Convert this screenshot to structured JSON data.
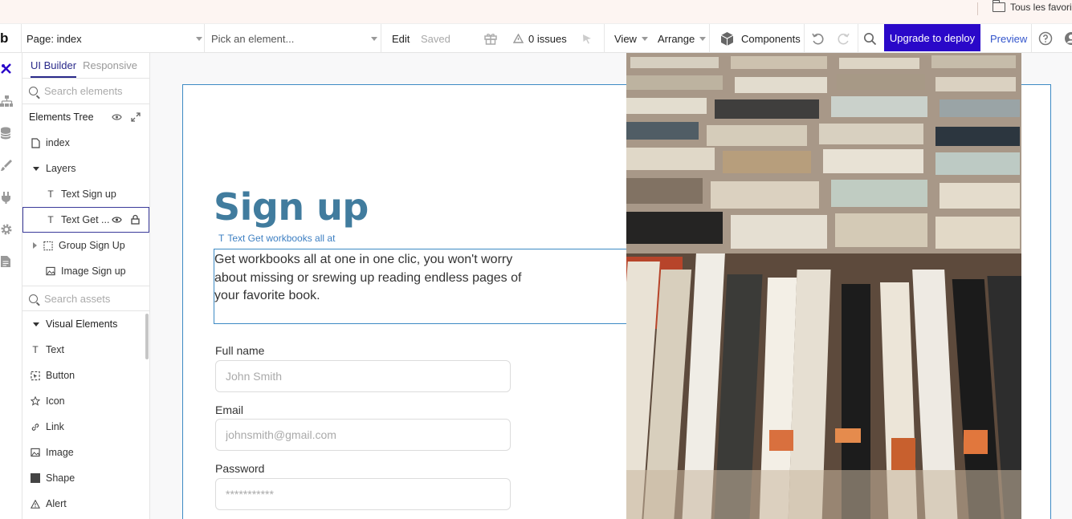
{
  "bookmarks": {
    "favorites_label": "Tous les favoris"
  },
  "toolbar": {
    "logo": "b",
    "page_select": "Page: index",
    "element_picker_placeholder": "Pick an element...",
    "edit_label": "Edit",
    "saved_label": "Saved",
    "issues_label": "0 issues",
    "view_label": "View",
    "arrange_label": "Arrange",
    "components_label": "Components",
    "deploy_label": "Upgrade to deploy",
    "preview_label": "Preview"
  },
  "panel": {
    "tabs": [
      "UI Builder",
      "Responsive"
    ],
    "search_elements_placeholder": "Search elements",
    "tree_title": "Elements Tree",
    "tree_items": {
      "index": "index",
      "layers": "Layers",
      "text_sign_up": "Text Sign up",
      "text_get": "Text Get ...",
      "group_sign_up": "Group Sign Up",
      "image_sign_up": "Image Sign up"
    },
    "search_assets_placeholder": "Search assets",
    "visual_elements_title": "Visual Elements",
    "visual_elements": [
      "Text",
      "Button",
      "Icon",
      "Link",
      "Image",
      "Shape",
      "Alert"
    ]
  },
  "canvas": {
    "title": "Sign up",
    "selection_label": "Text Get workbooks all at",
    "description": "Get workbooks all at one in one clic, you won't worry about missing or srewing up reading endless pages of your favorite book.",
    "fields": {
      "name_label": "Full name",
      "name_placeholder": "John Smith",
      "email_label": "Email",
      "email_placeholder": "johnsmith@gmail.com",
      "password_label": "Password",
      "password_placeholder": "***********"
    }
  },
  "colors": {
    "accent": "#2a08c9",
    "title": "#417c9e",
    "selection": "#3d8ac4"
  }
}
